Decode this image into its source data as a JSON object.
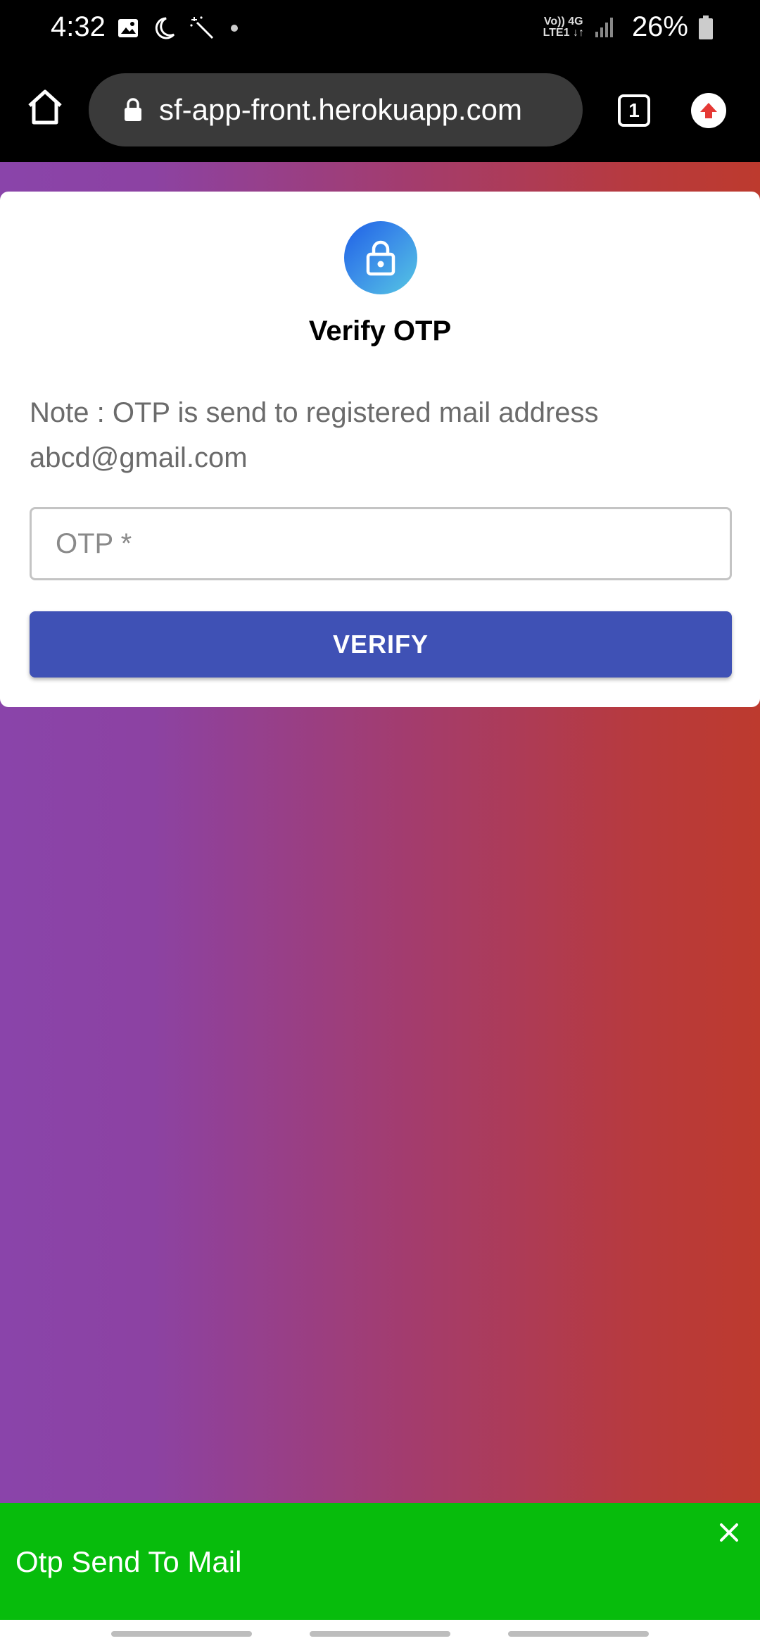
{
  "status_bar": {
    "time": "4:32",
    "network_line1": "Vo)) 4G",
    "network_line2": "LTE1 ↓↑",
    "battery": "26%",
    "icons": [
      "image-icon",
      "moon-icon",
      "wand-icon",
      "dot-icon",
      "signal-icon",
      "battery-icon"
    ]
  },
  "browser": {
    "url": "sf-app-front.herokuapp.com",
    "tab_count": "1",
    "icons": [
      "home-icon",
      "lock-icon",
      "tabs-icon",
      "update-icon"
    ],
    "update_color": "#e53935"
  },
  "card": {
    "title": "Verify OTP",
    "note_line1": "Note : OTP is send to registered mail address",
    "note_line2": "abcd@gmail.com",
    "otp_placeholder": "OTP *",
    "otp_value": "",
    "verify_label": "VERIFY",
    "button_color": "#3f51b5"
  },
  "toast": {
    "message": "Otp Send To Mail",
    "color": "#07bc0c"
  }
}
